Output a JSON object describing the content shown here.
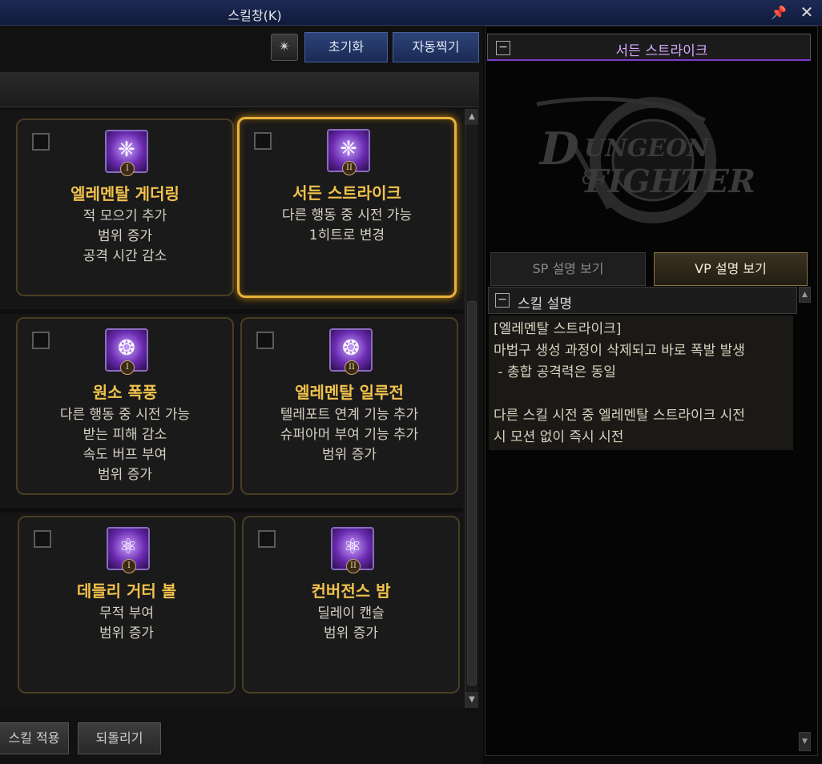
{
  "window": {
    "title": "스킬창(K)"
  },
  "toolbar": {
    "reset_label": "초기화",
    "auto_label": "자동찍기"
  },
  "cards": [
    {
      "name": "엘레멘탈 게더링",
      "rank": "I",
      "lines": [
        "적 모으기 추가",
        "범위 증가",
        "공격 시간 감소"
      ]
    },
    {
      "name": "서든 스트라이크",
      "rank": "II",
      "lines": [
        "다른 행동 중 시전 가능",
        "1히트로 변경"
      ]
    },
    {
      "name": "원소 폭풍",
      "rank": "I",
      "lines": [
        "다른 행동 중 시전 가능",
        "받는 피해 감소",
        "속도 버프 부여",
        "범위 증가"
      ]
    },
    {
      "name": "엘레멘탈 일루전",
      "rank": "II",
      "lines": [
        "텔레포트 연계 기능 추가",
        "슈퍼아머 부여 기능 추가",
        "범위 증가"
      ]
    },
    {
      "name": "데들리 거터 볼",
      "rank": "I",
      "lines": [
        "무적 부여",
        "범위 증가"
      ]
    },
    {
      "name": "컨버전스 밤",
      "rank": "II",
      "lines": [
        "딜레이 캔슬",
        "범위 증가"
      ]
    }
  ],
  "bottom": {
    "apply_label": "스킬 적용",
    "undo_label": "되돌리기"
  },
  "detail": {
    "title": "서든 스트라이크",
    "tab_sp": "SP 설명 보기",
    "tab_vp": "VP 설명 보기",
    "section_title": "스킬 설명",
    "lines": [
      "[엘레멘탈 스트라이크]",
      "마법구 생성 과정이 삭제되고 바로 폭발 발생",
      " - 총합 공격력은 동일",
      "",
      "다른 스킬 시전 중 엘레멘탈 스트라이크 시전",
      "시 모션 없이 즉시 시전"
    ]
  },
  "icons": {
    "pin": "pin-icon",
    "close": "close-icon"
  },
  "colors": {
    "gold": "#f2c24c",
    "selected_border": "#e8b23a",
    "purple_title": "#d8a8ff",
    "blue_button": "#2d4378"
  }
}
